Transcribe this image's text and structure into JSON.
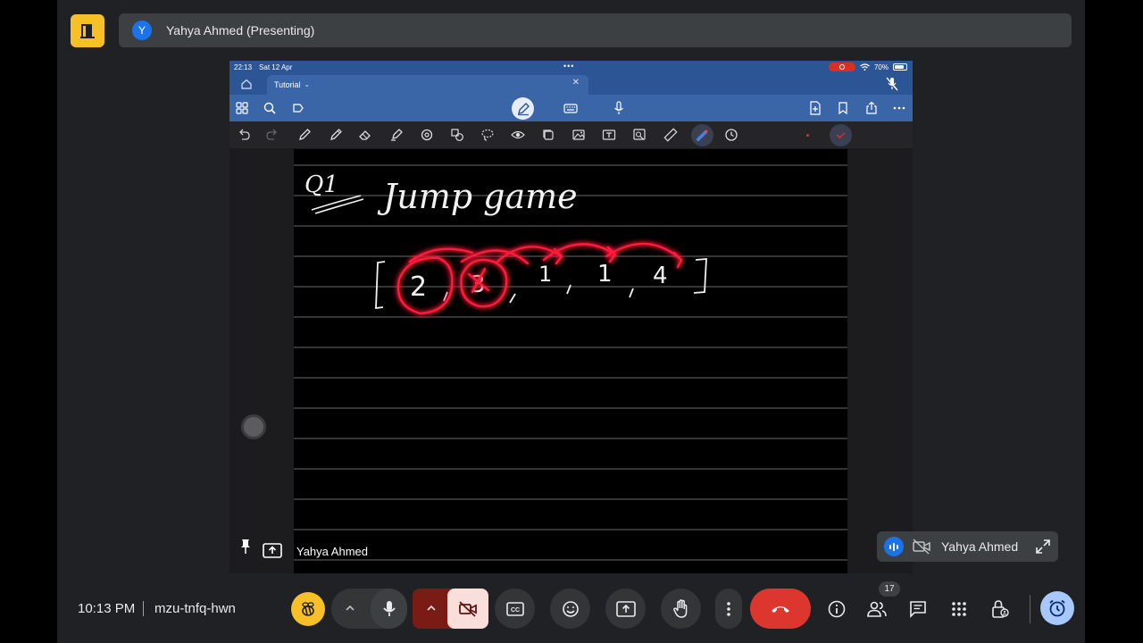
{
  "presenter_bar": {
    "avatar_letter": "Y",
    "label": "Yahya Ahmed (Presenting)"
  },
  "shared_screen": {
    "status_bar": {
      "time": "22:13",
      "date": "Sat 12 Apr",
      "battery": "70%"
    },
    "tab": {
      "title": "Tutorial"
    },
    "notes": {
      "handwriting_prefix": "Q1",
      "handwriting_title": "Jump game",
      "array_values": [
        "2",
        "3",
        "1",
        "1",
        "4"
      ]
    }
  },
  "tile": {
    "presenter_name": "Yahya Ahmed"
  },
  "self_view": {
    "name": "Yahya Ahmed"
  },
  "bottom_bar": {
    "time": "10:13 PM",
    "separator": "|",
    "meeting_code": "mzu-tnfq-hwn",
    "people_count": "17"
  },
  "colors": {
    "accent_blue": "#1a73e8",
    "brand_yellow": "#f6c026",
    "end_call_red": "#dc362e",
    "laser_red": "#ff1a3a",
    "app_header_blue": "#3a66a8"
  }
}
